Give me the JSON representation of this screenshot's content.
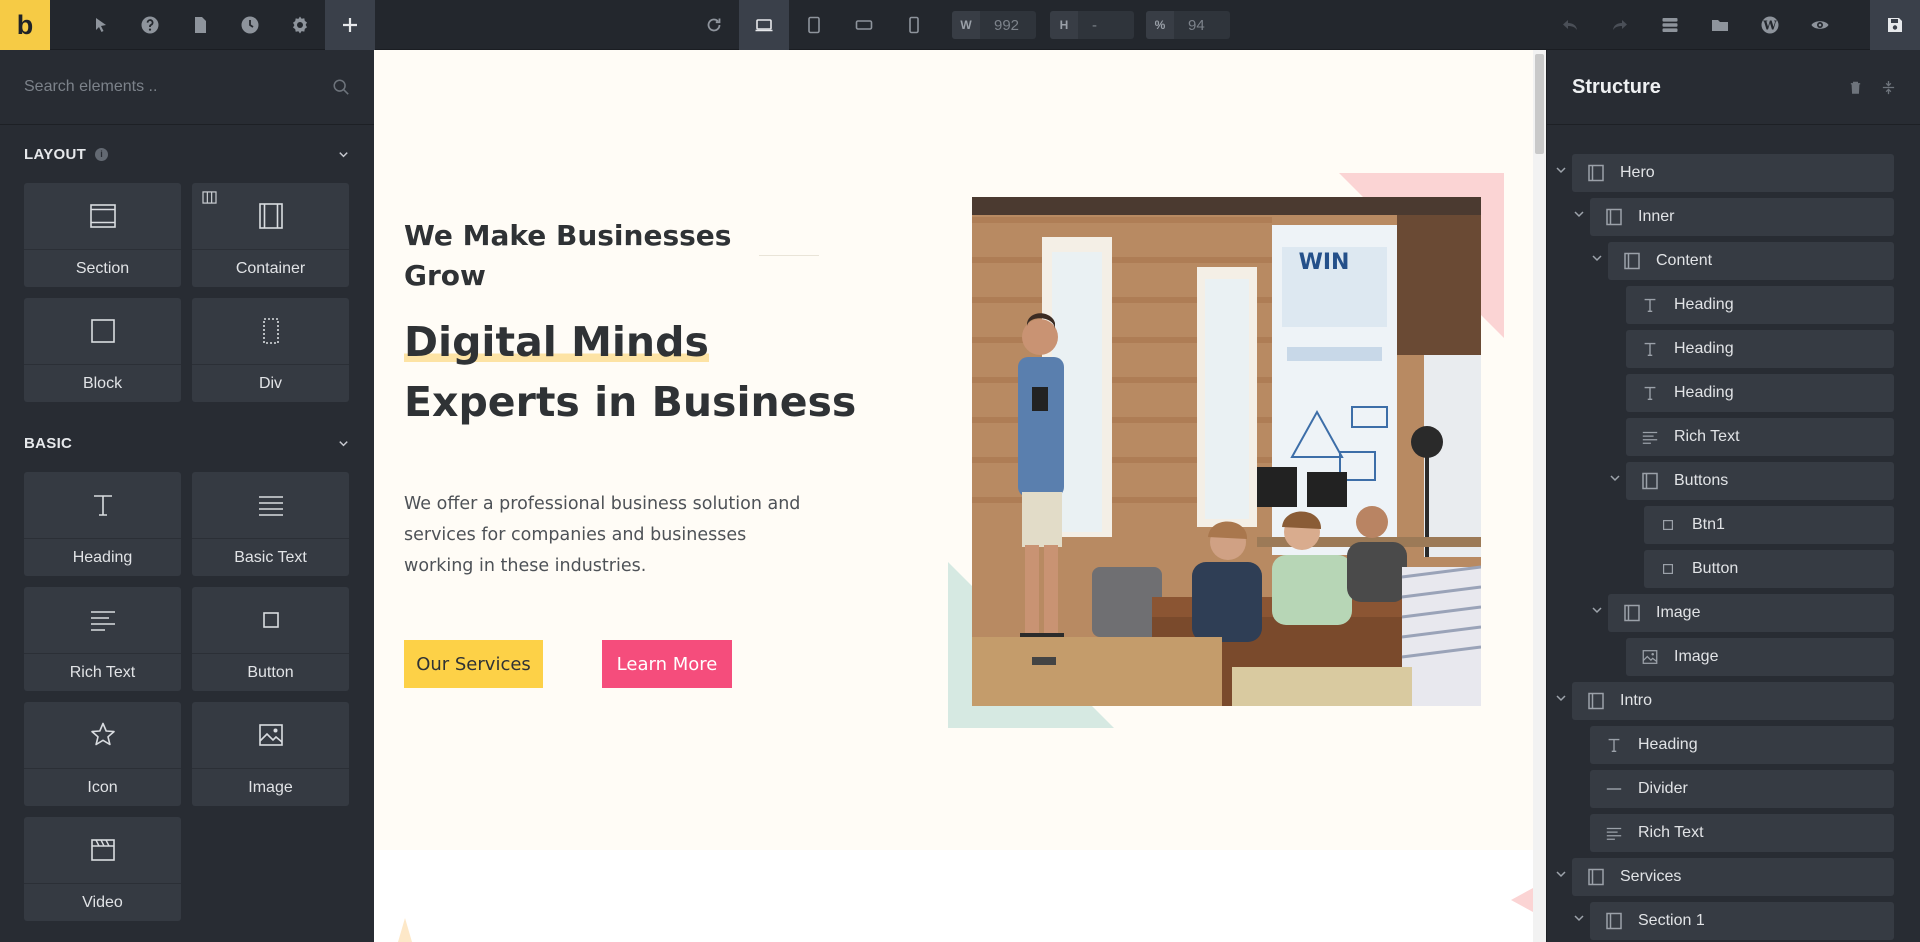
{
  "toolbar": {
    "logo": "b",
    "width_label": "W",
    "width_value": "992",
    "height_label": "H",
    "height_value": "-",
    "zoom_label": "%",
    "zoom_value": "94"
  },
  "elements_panel": {
    "search_placeholder": "Search elements ..",
    "categories": [
      {
        "title": "LAYOUT",
        "items": [
          "Section",
          "Container",
          "Block",
          "Div"
        ]
      },
      {
        "title": "BASIC",
        "items": [
          "Heading",
          "Basic Text",
          "Rich Text",
          "Button",
          "Icon",
          "Image",
          "Video"
        ]
      }
    ]
  },
  "hero": {
    "subheading": "We Make Businesses Grow",
    "heading_highlight": "Digital Minds",
    "heading_rest": "Experts in Business",
    "text": "We offer a professional business solution and services for companies and businesses working in these industries.",
    "btn_primary": "Our Services",
    "btn_secondary": "Learn More",
    "colors": {
      "yellow": "#fdd147",
      "pink": "#f54d7c",
      "background": "#fffcf6"
    }
  },
  "structure": {
    "title": "Structure",
    "nodes": [
      {
        "label": "Hero",
        "icon": "container-icon"
      },
      {
        "label": "Inner",
        "icon": "container-icon"
      },
      {
        "label": "Content",
        "icon": "container-icon"
      },
      {
        "label": "Heading",
        "icon": "heading-icon"
      },
      {
        "label": "Heading",
        "icon": "heading-icon"
      },
      {
        "label": "Heading",
        "icon": "heading-icon"
      },
      {
        "label": "Rich Text",
        "icon": "rich-text-icon"
      },
      {
        "label": "Buttons",
        "icon": "container-icon"
      },
      {
        "label": "Btn1",
        "icon": "button-icon"
      },
      {
        "label": "Button",
        "icon": "button-icon"
      },
      {
        "label": "Image",
        "icon": "container-icon"
      },
      {
        "label": "Image",
        "icon": "image-icon"
      },
      {
        "label": "Intro",
        "icon": "container-icon"
      },
      {
        "label": "Heading",
        "icon": "heading-icon"
      },
      {
        "label": "Divider",
        "icon": "divider-icon"
      },
      {
        "label": "Rich Text",
        "icon": "rich-text-icon"
      },
      {
        "label": "Services",
        "icon": "container-icon"
      },
      {
        "label": "Section 1",
        "icon": "container-icon"
      }
    ]
  }
}
